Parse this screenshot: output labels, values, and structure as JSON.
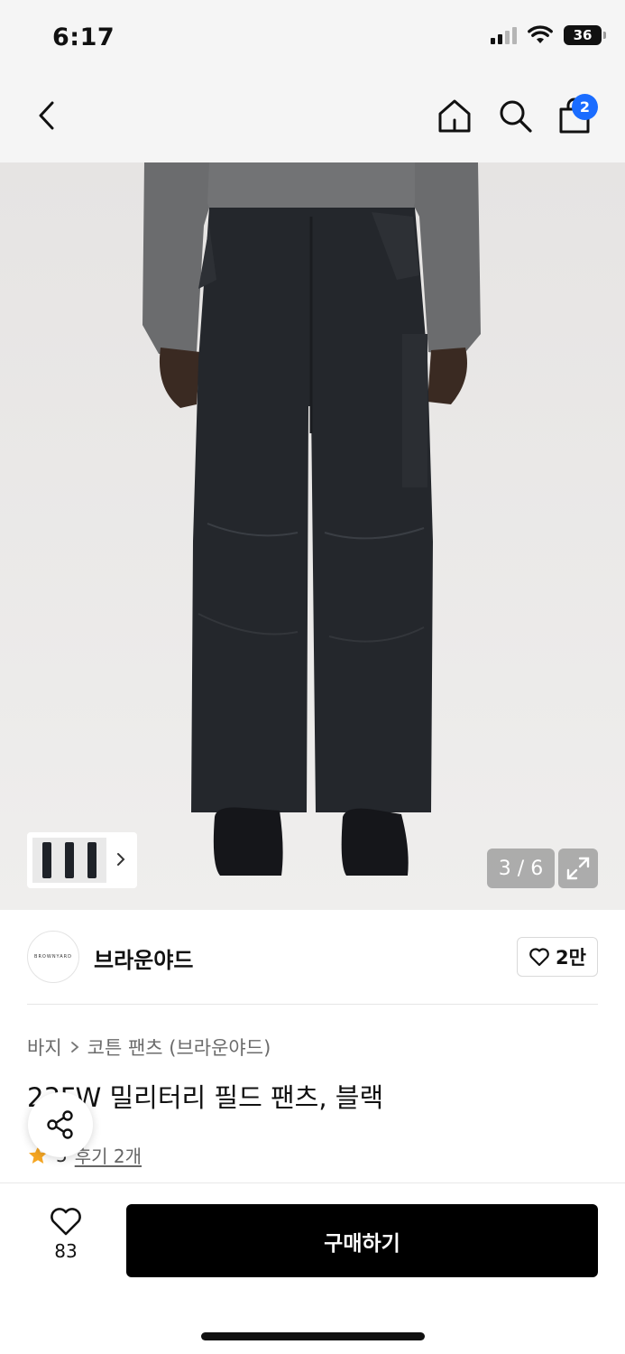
{
  "status": {
    "time": "6:17",
    "battery": "36"
  },
  "nav": {
    "back_icon": "chevron-left-icon",
    "home_icon": "home-icon",
    "search_icon": "search-icon",
    "bag_icon": "shopping-bag-icon",
    "cart_count": "2"
  },
  "gallery": {
    "counter": "3 / 6",
    "expand_icon": "expand-icon",
    "thumbnail_chevron_icon": "chevron-right-icon"
  },
  "brand": {
    "logo_text": "BROWNYARD",
    "name": "브라운야드",
    "like_label": "2만"
  },
  "product": {
    "breadcrumb": [
      "바지",
      "코튼 팬츠 (브라운야드)"
    ],
    "title": "23FW 밀리터리 필드 팬츠, 블랙",
    "rating_value": "5",
    "reviews": "후기 2개"
  },
  "actions": {
    "wish_count": "83",
    "buy_label": "구매하기",
    "share_icon": "share-icon",
    "heart_icon": "heart-icon"
  },
  "colors": {
    "accent_badge": "#1a6cff",
    "buy_button": "#000000",
    "star": "#f5a623"
  }
}
